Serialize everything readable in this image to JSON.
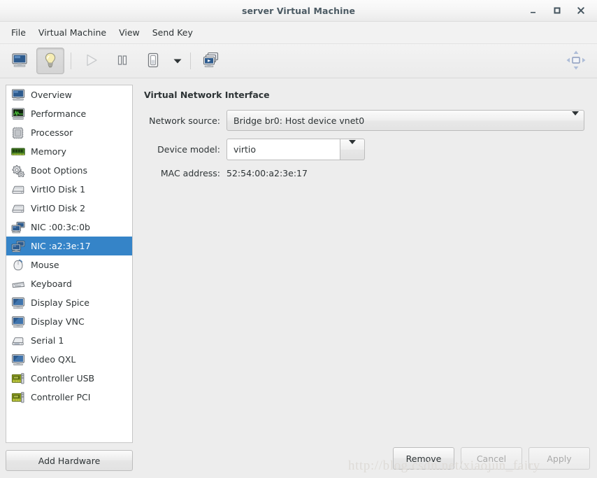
{
  "window": {
    "title": "server Virtual Machine",
    "buttons": {
      "minimize": "minimize",
      "maximize": "maximize",
      "close": "close"
    }
  },
  "menubar": {
    "items": [
      {
        "label": "File"
      },
      {
        "label": "Virtual Machine"
      },
      {
        "label": "View"
      },
      {
        "label": "Send Key"
      }
    ]
  },
  "toolbar": {
    "items": [
      {
        "name": "show-console-button",
        "icon": "monitor-icon",
        "state": "normal"
      },
      {
        "name": "show-details-button",
        "icon": "lightbulb-icon",
        "state": "pressed"
      },
      {
        "name": "run-button",
        "icon": "play-icon",
        "state": "disabled"
      },
      {
        "name": "pause-button",
        "icon": "pause-icon",
        "state": "normal"
      },
      {
        "name": "shutdown-button",
        "icon": "power-switch-icon",
        "state": "normal"
      },
      {
        "name": "shutdown-menu-button",
        "icon": "chevron-down-icon",
        "state": "normal"
      },
      {
        "name": "snapshots-button",
        "icon": "snapshots-icon",
        "state": "normal"
      }
    ],
    "fullscreen": {
      "name": "fullscreen-button",
      "icon": "resize-arrows-icon"
    }
  },
  "sidebar": {
    "items": [
      {
        "label": "Overview",
        "icon": "monitor-icon",
        "selected": false
      },
      {
        "label": "Performance",
        "icon": "graph-icon",
        "selected": false
      },
      {
        "label": "Processor",
        "icon": "cpu-icon",
        "selected": false
      },
      {
        "label": "Memory",
        "icon": "memory-icon",
        "selected": false
      },
      {
        "label": "Boot Options",
        "icon": "gears-icon",
        "selected": false
      },
      {
        "label": "VirtIO Disk 1",
        "icon": "disk-icon",
        "selected": false
      },
      {
        "label": "VirtIO Disk 2",
        "icon": "disk-icon",
        "selected": false
      },
      {
        "label": "NIC :00:3c:0b",
        "icon": "network-icon",
        "selected": false
      },
      {
        "label": "NIC :a2:3e:17",
        "icon": "network-icon",
        "selected": true
      },
      {
        "label": "Mouse",
        "icon": "mouse-icon",
        "selected": false
      },
      {
        "label": "Keyboard",
        "icon": "keyboard-icon",
        "selected": false
      },
      {
        "label": "Display Spice",
        "icon": "display-icon",
        "selected": false
      },
      {
        "label": "Display VNC",
        "icon": "display-icon",
        "selected": false
      },
      {
        "label": "Serial 1",
        "icon": "serial-icon",
        "selected": false
      },
      {
        "label": "Video QXL",
        "icon": "display-icon",
        "selected": false
      },
      {
        "label": "Controller USB",
        "icon": "card-icon",
        "selected": false
      },
      {
        "label": "Controller PCI",
        "icon": "card-icon",
        "selected": false
      }
    ],
    "add_hardware_label": "Add Hardware"
  },
  "main": {
    "panel_title": "Virtual Network Interface",
    "fields": {
      "network_source_label": "Network source:",
      "network_source_value": "Bridge br0: Host device vnet0",
      "device_model_label": "Device model:",
      "device_model_value": "virtio",
      "mac_address_label": "MAC address:",
      "mac_address_value": "52:54:00:a2:3e:17"
    }
  },
  "footer": {
    "remove_label": "Remove",
    "cancel_label": "Cancel",
    "apply_label": "Apply"
  },
  "watermark": {
    "text": "http://blog.csdn.net/xiaojun_fairy"
  },
  "colors": {
    "selection": "#3584c8",
    "background": "#ededed",
    "list_background": "#ffffff",
    "text": "#2e3436",
    "title_text": "#4b5a63"
  }
}
